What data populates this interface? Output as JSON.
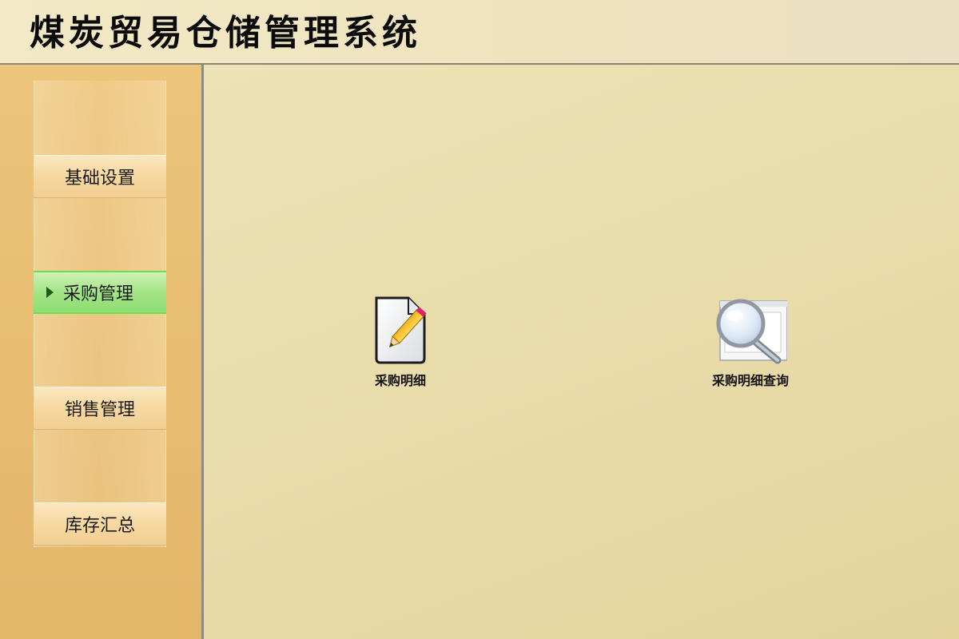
{
  "header": {
    "title": "煤炭贸易仓储管理系统"
  },
  "sidebar": {
    "items": [
      {
        "label": "基础设置"
      },
      {
        "label": "采购管理"
      },
      {
        "label": "销售管理"
      },
      {
        "label": "库存汇总"
      }
    ],
    "active_index": 1
  },
  "main": {
    "shortcuts": [
      {
        "label": "采购明细",
        "icon": "edit-document-icon"
      },
      {
        "label": "采购明细查询",
        "icon": "search-magnifier-icon"
      }
    ]
  },
  "colors": {
    "active_item": "#a3e487",
    "sidebar_bg": "#e8bd72",
    "main_bg": "#e9dcaa"
  }
}
